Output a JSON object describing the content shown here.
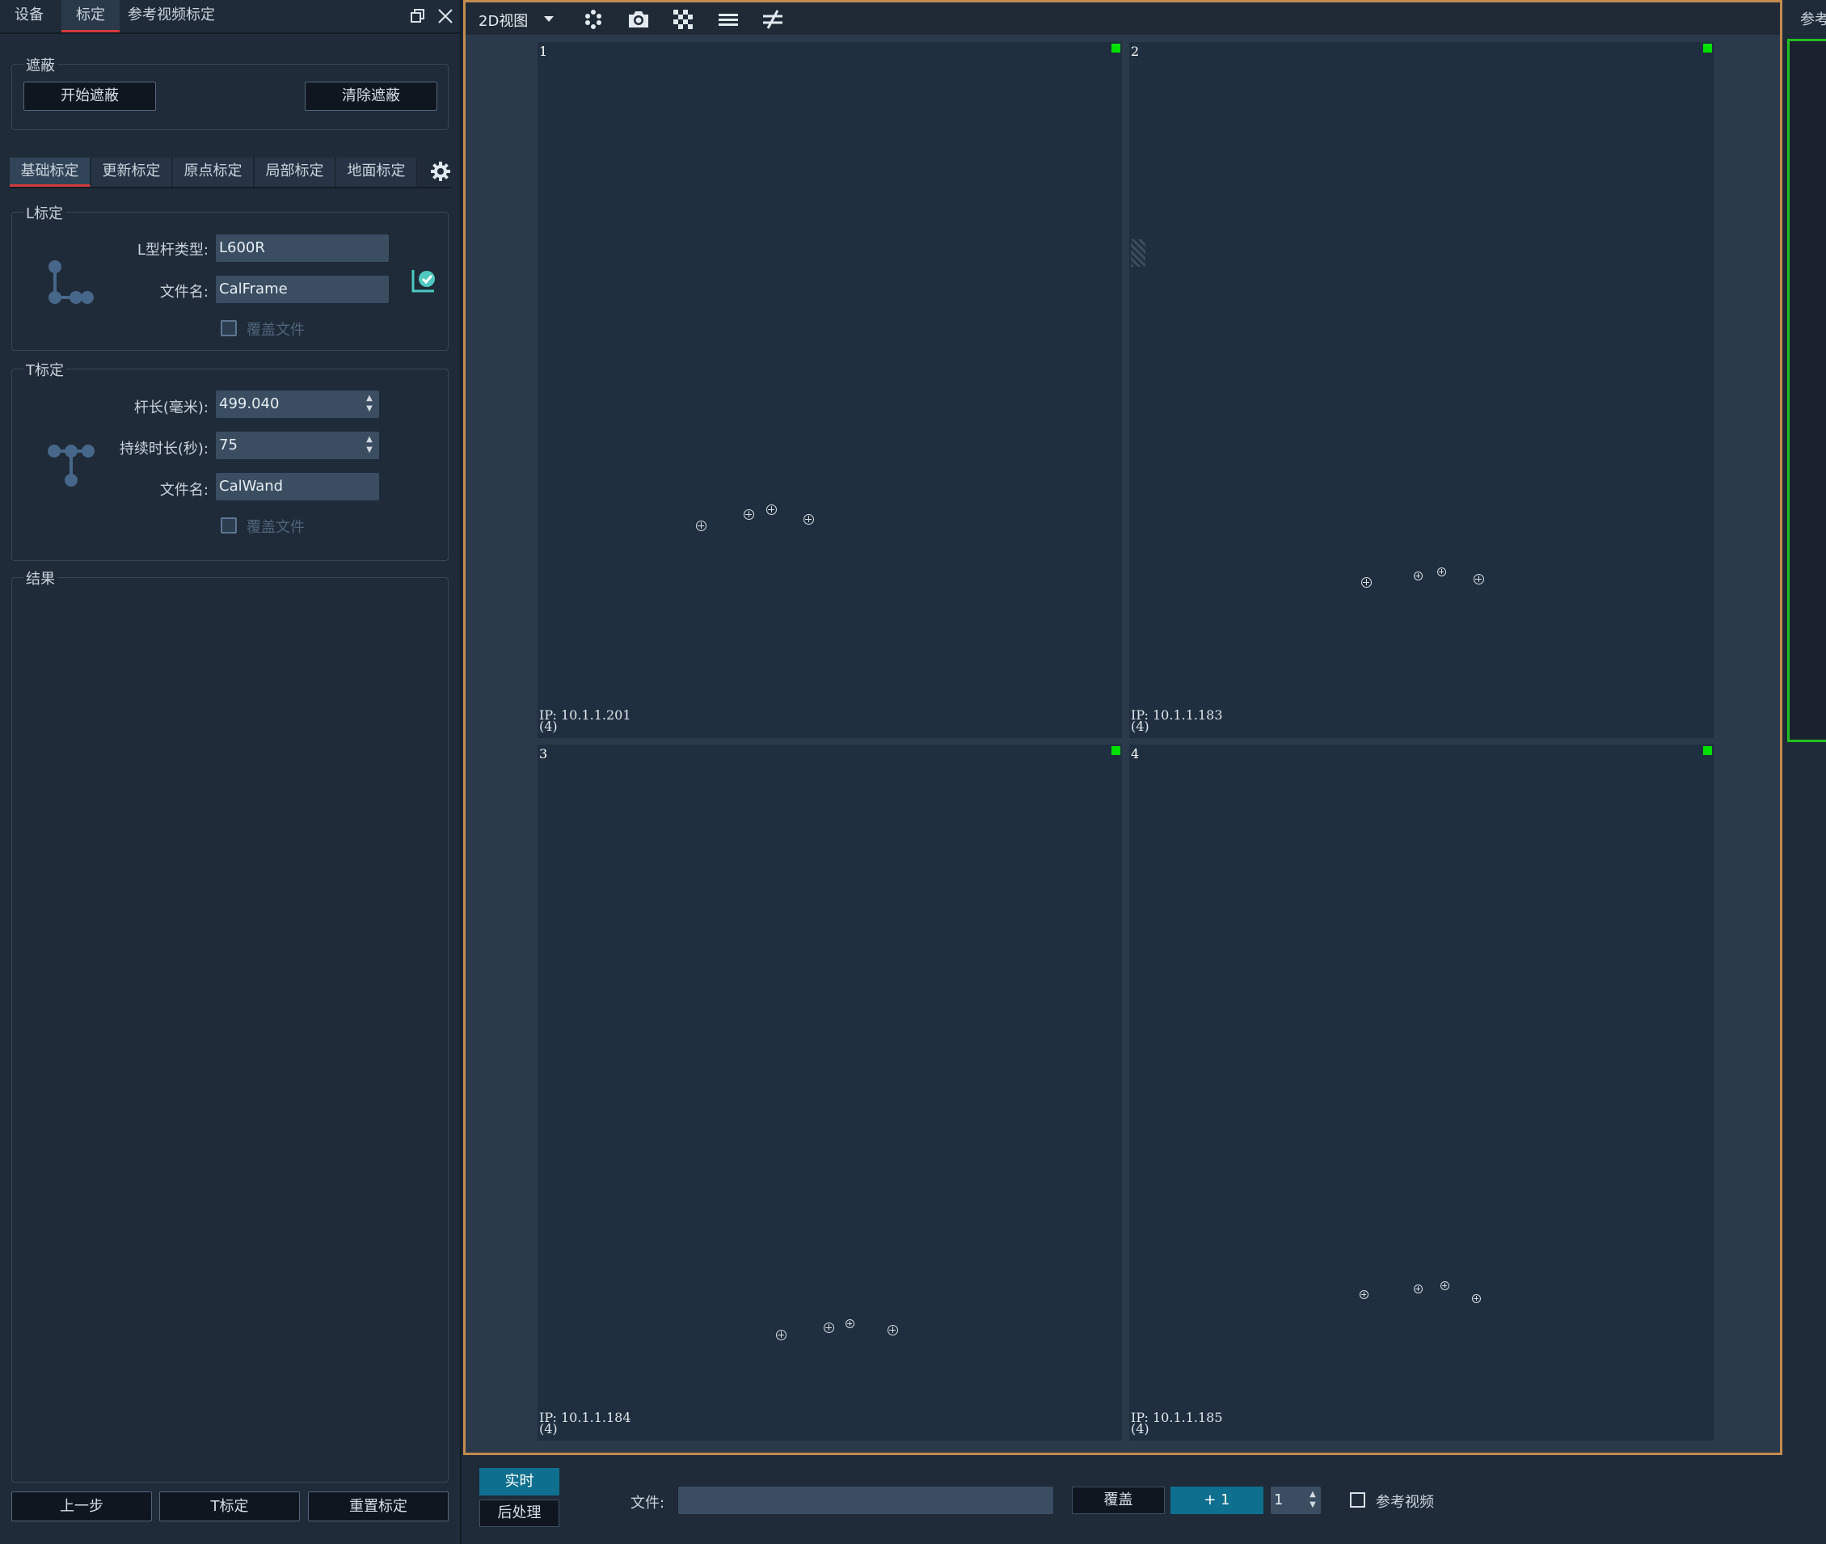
{
  "panel_tabs": [
    "设备",
    "标定",
    "参考视频标定"
  ],
  "mask": {
    "title": "遮蔽",
    "start_button": "开始遮蔽",
    "clear_button": "清除遮蔽"
  },
  "sub_tabs": [
    "基础标定",
    "更新标定",
    "原点标定",
    "局部标定",
    "地面标定"
  ],
  "l_calib": {
    "title": "L标定",
    "type_label": "L型杆类型:",
    "type_value": "L600R",
    "file_label": "文件名:",
    "file_value": "CalFrame",
    "overwrite_label": "覆盖文件"
  },
  "t_calib": {
    "title": "T标定",
    "length_label": "杆长(毫米):",
    "length_value": "499.040",
    "duration_label": "持续时长(秒):",
    "duration_value": "75",
    "file_label": "文件名:",
    "file_value": "CalWand",
    "overwrite_label": "覆盖文件"
  },
  "result": {
    "title": "结果"
  },
  "footer_buttons": {
    "prev": "上一步",
    "t_calib": "T标定",
    "reset": "重置标定"
  },
  "toolbar": {
    "view_mode": "2D视图",
    "icons": [
      "dots-icon",
      "camera-icon",
      "checker-icon",
      "menu-icon",
      "not-equal-icon"
    ]
  },
  "cameras": [
    {
      "num": "1",
      "ip": "IP: 10.1.1.201",
      "count": "(4)"
    },
    {
      "num": "2",
      "ip": "IP: 10.1.1.183",
      "count": "(4)"
    },
    {
      "num": "3",
      "ip": "IP: 10.1.1.184",
      "count": "(4)"
    },
    {
      "num": "4",
      "ip": "IP: 10.1.1.185",
      "count": "(4)"
    }
  ],
  "right_panel": {
    "label": "参考"
  },
  "bottom": {
    "realtime": "实时",
    "post": "后处理",
    "file_label": "文件:",
    "file_value": "",
    "overwrite": "覆盖",
    "plus": "+ 1",
    "step_value": "1",
    "ref_video_label": "参考视频"
  },
  "colors": {
    "accent_red": "#d23a3a",
    "view_border": "#c48b4f",
    "status_green": "#00e000",
    "teal": "#0e6f8f"
  }
}
